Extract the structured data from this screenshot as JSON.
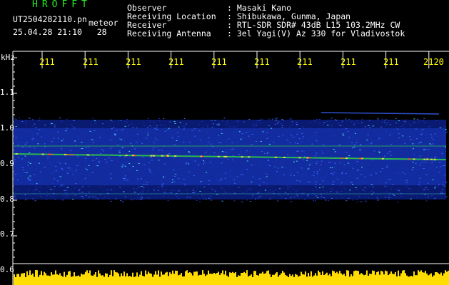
{
  "program": "HROFFT",
  "file": {
    "filename": "UT2504282110.pn",
    "mode": "meteor",
    "datetime": "25.04.28 21:10",
    "count": "28"
  },
  "header": {
    "observer_label": "Observer",
    "observer_value": "Masaki Kano",
    "location_label": "Receiving Location",
    "location_value": "Shibukawa, Gunma, Japan",
    "receiver_label": "Receiver",
    "receiver_value": "RTL-SDR SDR# 43dB L15 103.2MHz CW",
    "antenna_label": "Receiving Antenna",
    "antenna_value": "3el Yagi(V) Az 330 for Vladivostok"
  },
  "axis": {
    "unit": "kHz",
    "y_ticks": [
      "1.1",
      "1.0",
      "0.9",
      "0.8",
      "0.7",
      "0.6"
    ],
    "x_ticks": [
      "211",
      "211",
      "211",
      "211",
      "211",
      "211",
      "211",
      "211",
      "211",
      "2120"
    ]
  },
  "colors": {
    "background": "#000000",
    "header_text": "#ffffff",
    "program_text": "#22ee22",
    "tick_text": "#ffff00",
    "signal_band": "#1a3cc8",
    "echo_line": "#30d040",
    "noise_bar": "#ffdd00"
  }
}
